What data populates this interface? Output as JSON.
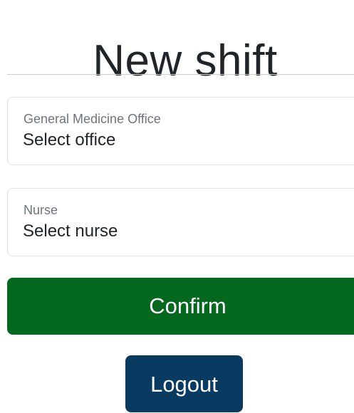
{
  "page": {
    "title": "New shift"
  },
  "form": {
    "office": {
      "label": "General Medicine Office",
      "value": "Select office"
    },
    "nurse": {
      "label": "Nurse",
      "value": "Select nurse"
    },
    "confirm_label": "Confirm"
  },
  "actions": {
    "logout_label": "Logout"
  },
  "colors": {
    "confirm_bg": "#04681f",
    "logout_bg": "#083a62",
    "text": "#212529",
    "label": "#6c757d",
    "border": "#dee2e6"
  }
}
